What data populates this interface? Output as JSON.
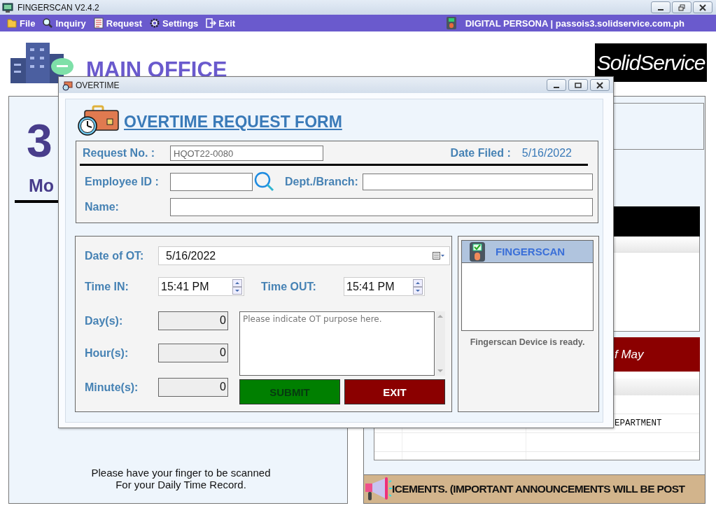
{
  "window": {
    "title": "FINGERSCAN V2.4.2"
  },
  "menu": [
    {
      "label": "File"
    },
    {
      "label": "Inquiry"
    },
    {
      "label": "Request"
    },
    {
      "label": "Settings"
    },
    {
      "label": "Exit"
    }
  ],
  "device_info": "DIGITAL PERSONA | passois3.solidservice.com.ph",
  "header": {
    "office": "MAIN OFFICE",
    "logo": "SolidService"
  },
  "left_panel": {
    "big_number": "3",
    "subtitle": "Mo",
    "footer_lines": [
      "Please have your finger to be scanned",
      "For your Daily Time Record."
    ]
  },
  "right_panel": {
    "banner": "f May",
    "table_cell": "EPARTMENT",
    "announcement": "ICEMENTS. (IMPORTANT ANNOUNCEMENTS WILL BE POST"
  },
  "dialog": {
    "title": "OVERTIME",
    "heading": "OVERTIME REQUEST FORM",
    "request_no": {
      "label": "Request No. :",
      "value": "HQOT22-0080"
    },
    "date_filed": {
      "label": "Date Filed :",
      "value": "5/16/2022"
    },
    "employee_id": {
      "label": "Employee ID :"
    },
    "dept_branch": {
      "label": "Dept./Branch:"
    },
    "name": {
      "label": "Name:"
    },
    "date_of_ot": {
      "label": "Date of OT:",
      "value": "5/16/2022"
    },
    "time_in": {
      "label": "Time IN:",
      "value": "15:41 PM"
    },
    "time_out": {
      "label": "Time OUT:",
      "value": "15:41 PM"
    },
    "durations": [
      {
        "label": "Day(s):",
        "value": "0"
      },
      {
        "label": "Hour(s):",
        "value": "0"
      },
      {
        "label": "Minute(s):",
        "value": "0"
      }
    ],
    "purpose": {
      "placeholder": "Please indicate OT purpose here."
    },
    "buttons": [
      {
        "label": "SUBMIT",
        "kind": "submit"
      },
      {
        "label": "EXIT",
        "kind": "exit"
      }
    ],
    "fingerscan": {
      "title": "FINGERSCAN",
      "status": "Fingerscan Device is ready."
    }
  }
}
